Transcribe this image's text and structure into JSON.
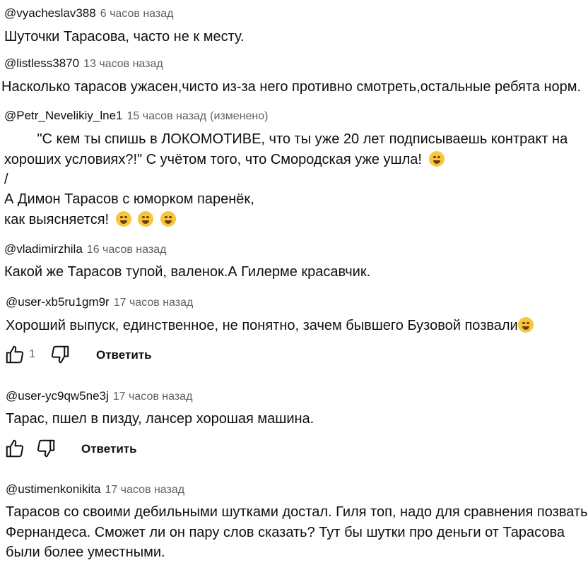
{
  "comments": [
    {
      "author": "@vyacheslav388",
      "time": "6 часов назад",
      "lines": [
        "Шуточки Тарасова, часто не к месту."
      ]
    },
    {
      "author": "@listless3870",
      "time": "13 часов назад",
      "lines": [
        "Насколько тарасов ужасен,чисто из-за него противно смотреть,остальные ребята норм."
      ]
    },
    {
      "author": "@Petr_Nevelikiy_lne1",
      "time": "15 часов назад",
      "edited": "(изменено)",
      "lines": [
        "        \"С кем ты спишь в ЛОКОМОТИВЕ, что ты уже 20 лет подписываешь контракт на",
        "хороших условиях?!\" С учётом того, что Смородская уже ушла!",
        "/",
        "А Димон Тарасов с юморком паренёк,",
        "как выясняется!"
      ]
    },
    {
      "author": "@vladimirzhila",
      "time": "16 часов назад",
      "lines": [
        "Какой же Тарасов тупой, валенок.А Гилерме красавчик."
      ]
    },
    {
      "author": "@user-xb5ru1gm9r",
      "time": "17 часов назад",
      "lines": [
        "Хороший выпуск, единственное, не понятно, зачем бывшего Бузовой позвали"
      ],
      "likes": "1",
      "reply": "Ответить"
    },
    {
      "author": "@user-yc9qw5ne3j",
      "time": "17 часов назад",
      "lines": [
        "Тарас, пшел в пизду, лансер хорошая машина."
      ],
      "reply": "Ответить"
    },
    {
      "author": "@ustimenkonikita",
      "time": "17 часов назад",
      "lines": [
        "Тарасов со своими дебильными шутками достал. Гиля топ, надо для сравнения позвать",
        "Фернандеса. Сможет ли он пару слов сказать? Тут бы шутки про деньги от Тарасова",
        "были более уместными."
      ]
    }
  ],
  "icons": {
    "like": "thumbs-up-icon",
    "dislike": "thumbs-down-icon",
    "emoji": "emoji-icon"
  }
}
